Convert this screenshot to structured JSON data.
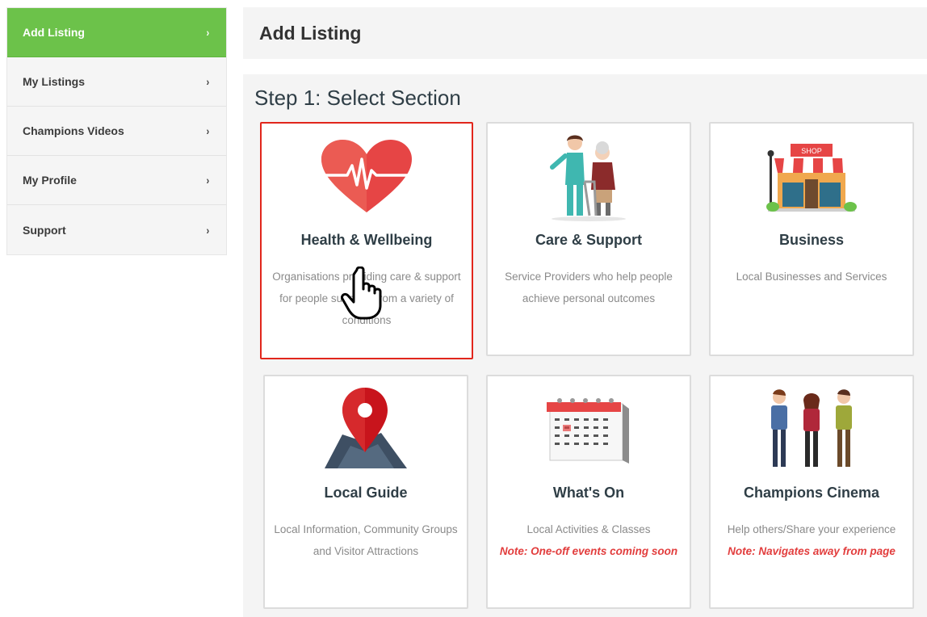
{
  "sidebar": {
    "items": [
      {
        "label": "Add Listing",
        "active": true
      },
      {
        "label": "My Listings"
      },
      {
        "label": "Champions Videos"
      },
      {
        "label": "My Profile"
      },
      {
        "label": "Support"
      }
    ],
    "chevron": "›"
  },
  "header": {
    "title": "Add Listing"
  },
  "main": {
    "step_title": "Step 1: Select Section",
    "cards": [
      {
        "title": "Health & Wellbeing",
        "desc": "Organisations providing care & support for people suffering from a variety of conditions",
        "icon": "heart-pulse-icon",
        "selected": true
      },
      {
        "title": "Care & Support",
        "desc": "Service Providers who help people achieve personal outcomes",
        "icon": "caregiver-icon"
      },
      {
        "title": "Business",
        "desc": "Local Businesses and Services",
        "icon": "shop-icon",
        "shop_sign": "SHOP"
      },
      {
        "title": "Local Guide",
        "desc": "Local Information, Community Groups and Visitor Attractions",
        "icon": "map-pin-icon"
      },
      {
        "title": "What's On",
        "desc": "Local Activities & Classes",
        "note": "Note: One-off events coming soon",
        "icon": "calendar-icon"
      },
      {
        "title": "Champions Cinema",
        "desc": "Help others/Share your experience",
        "note": "Note: Navigates away from page",
        "icon": "people-icon"
      }
    ]
  },
  "colors": {
    "accent_green": "#6cc24a",
    "selected_border": "#e1261c",
    "note_red": "#e23d3d",
    "heart_red": "#e64545"
  }
}
